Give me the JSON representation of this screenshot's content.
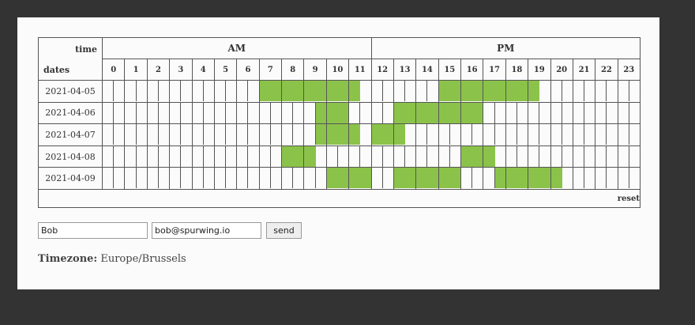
{
  "table": {
    "corner_time": "time",
    "corner_dates": "dates",
    "am_label": "AM",
    "pm_label": "PM",
    "hours": [
      "0",
      "1",
      "2",
      "3",
      "4",
      "5",
      "6",
      "7",
      "8",
      "9",
      "10",
      "11",
      "12",
      "13",
      "14",
      "15",
      "16",
      "17",
      "18",
      "19",
      "20",
      "21",
      "22",
      "23"
    ],
    "rows": [
      {
        "date": "2021-04-05",
        "selected_half_slots": [
          14,
          15,
          16,
          17,
          18,
          19,
          20,
          21,
          22,
          30,
          31,
          32,
          33,
          34,
          35,
          36,
          37,
          38
        ]
      },
      {
        "date": "2021-04-06",
        "selected_half_slots": [
          19,
          20,
          21,
          26,
          27,
          28,
          29,
          30,
          31,
          32,
          33
        ]
      },
      {
        "date": "2021-04-07",
        "selected_half_slots": [
          19,
          20,
          21,
          22,
          24,
          25,
          26
        ]
      },
      {
        "date": "2021-04-08",
        "selected_half_slots": [
          16,
          17,
          18,
          32,
          33,
          34
        ]
      },
      {
        "date": "2021-04-09",
        "selected_half_slots": [
          20,
          21,
          22,
          23,
          26,
          27,
          28,
          29,
          30,
          31,
          35,
          36,
          37,
          38,
          39,
          40
        ]
      }
    ],
    "reset_label": "reset",
    "selected_color": "#8bc34a"
  },
  "form": {
    "name_value": "Bob",
    "email_value": "bob@spurwing.io",
    "send_label": "send"
  },
  "timezone": {
    "label": "Timezone:",
    "value": "Europe/Brussels"
  }
}
